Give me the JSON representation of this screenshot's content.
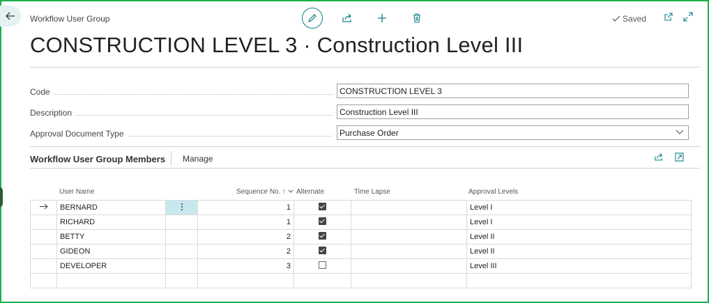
{
  "page": {
    "caption": "Workflow User Group",
    "title": "CONSTRUCTION LEVEL 3 · Construction Level III",
    "saved": "Saved"
  },
  "fields": {
    "code": {
      "label": "Code",
      "value": "CONSTRUCTION LEVEL 3"
    },
    "description": {
      "label": "Description",
      "value": "Construction Level III"
    },
    "doc_type": {
      "label": "Approval Document Type",
      "value": "Purchase Order"
    }
  },
  "members": {
    "title": "Workflow User Group Members",
    "manage": "Manage",
    "columns": {
      "user_name": "User Name",
      "sequence_no": "Sequence No.",
      "alternate": "Alternate",
      "time_lapse": "Time Lapse",
      "approval_levels": "Approval Levels"
    },
    "sort_indicator": "↑",
    "rows": [
      {
        "user": "BERNARD",
        "seq": "1",
        "alternate": true,
        "time_lapse": "",
        "level": "Level I"
      },
      {
        "user": "RICHARD",
        "seq": "1",
        "alternate": true,
        "time_lapse": "",
        "level": "Level I"
      },
      {
        "user": "BETTY",
        "seq": "2",
        "alternate": true,
        "time_lapse": "",
        "level": "Level II"
      },
      {
        "user": "GIDEON",
        "seq": "2",
        "alternate": true,
        "time_lapse": "",
        "level": "Level II"
      },
      {
        "user": "DEVELOPER",
        "seq": "3",
        "alternate": false,
        "time_lapse": "",
        "level": "Level III"
      },
      {
        "user": "",
        "seq": "",
        "alternate": null,
        "time_lapse": "",
        "level": ""
      }
    ]
  },
  "icons": {
    "back": "back-arrow-icon",
    "edit": "pencil-icon",
    "share": "share-icon",
    "new": "plus-icon",
    "delete": "trash-icon",
    "open_new": "open-in-new-window-icon",
    "expand": "expand-icon",
    "row_arrow": "arrow-right-icon",
    "row_menu": "more-vertical-icon"
  },
  "colors": {
    "accent": "#0a7c86",
    "frame": "#1db04b",
    "selected_cell": "#c7e8ee"
  }
}
